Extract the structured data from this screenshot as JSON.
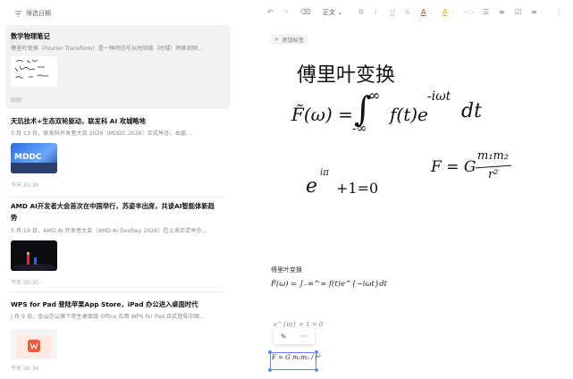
{
  "sidebar": {
    "filter_label": "筛选日期",
    "notes": [
      {
        "title": "数学物理笔记",
        "snippet": "傅里叶变换（Fourier Transform）是一种将信号从时间域（时域）转换到频...",
        "meta": "刚刚"
      },
      {
        "title": "天玑技术+生态双轮驱动，联发科 AI 攻城略地",
        "snippet": "5 月 13 日，联发科开发者大会 2026（MDDC 2026）正式举办。本届...",
        "meta": "今天 20:36",
        "thumb_text": "MDDC"
      },
      {
        "title_line1": "AMD AI开发者大会首次在中国举行，苏姿丰出席，共谈AI智能体新趋",
        "title_line2": "势",
        "snippet": "5 月 19 日，AMD AI 开发者大会（AMD AI DevDay 2026）在上海正式举办...",
        "meta": "今天 20:35"
      },
      {
        "title": "WPS for Pad 登陆苹果App Store，iPad 办公进入桌面时代",
        "snippet": "J 月 9 日，金山办公旗下常生桌面级 Office 应用 WPS for Pad 正式登陆中国...",
        "meta": "今天 20:34"
      }
    ]
  },
  "toolbar": {
    "undo": "↶",
    "redo": "↷",
    "clear_format": "⌫",
    "style_select": "正文",
    "bold": "B",
    "italic": "I",
    "underline": "U",
    "strikethrough": "S",
    "font_color": "A",
    "highlight": "A",
    "code": "</>",
    "bullet_list": "☰",
    "numbered_list": "≡",
    "checklist": "☑",
    "align": "≡",
    "more": "⋮"
  },
  "editor": {
    "add_tag_label": "添加标签",
    "handwriting": {
      "title": "傅里叶变换",
      "fourier_lhs": "F̃(ω) =",
      "integral_upper": "∞",
      "integral_lower": "-∞",
      "integrand": "f(t)e",
      "exponent": "-iωt",
      "dt": "dt",
      "euler": "e",
      "euler_exp": "iπ",
      "euler_rest": "+1=0",
      "gravity_lhs": "F = G",
      "gravity_num": "m₁m₂",
      "gravity_den": "r²"
    },
    "typed_title": "傅里叶变换",
    "typed_formula": "F̃(ω) = ∫₋∞^∞ f(t)e^{−iωt}dt",
    "partial_line": "e^{iπ} + 1 = 0",
    "mini_toolbar": {
      "edit": "✎",
      "more": "···"
    },
    "selected_formula": "F = G m₁m₂ / r²"
  },
  "colors": {
    "accent": "#5b8def",
    "active_card": "#f2f2f2"
  }
}
